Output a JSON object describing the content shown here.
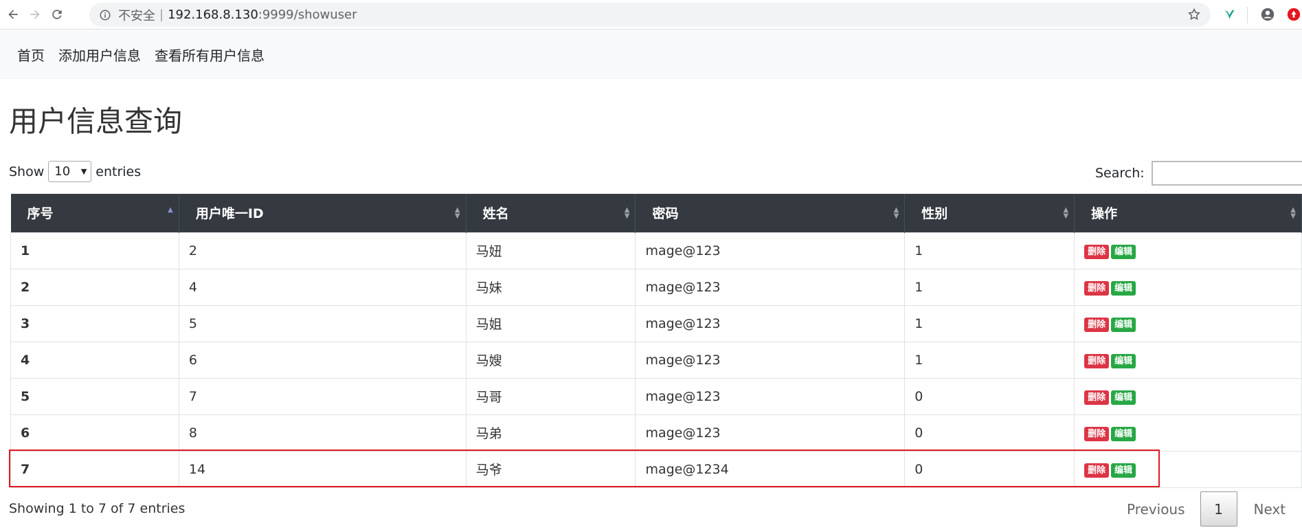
{
  "browser": {
    "insecure_label": "不安全",
    "separator": "|",
    "url_host": "192.168.8.130",
    "url_path": ":9999/showuser"
  },
  "navbar": {
    "home": "首页",
    "add_user": "添加用户信息",
    "view_all": "查看所有用户信息"
  },
  "page_title": "用户信息查询",
  "length": {
    "show": "Show",
    "value": "10",
    "entries": "entries"
  },
  "search": {
    "label": "Search:",
    "value": ""
  },
  "table": {
    "headers": [
      "序号",
      "用户唯一ID",
      "姓名",
      "密码",
      "性别",
      "操作"
    ],
    "rows": [
      {
        "idx": "1",
        "uid": "2",
        "name": "马妞",
        "pwd": "mage@123",
        "sex": "1"
      },
      {
        "idx": "2",
        "uid": "4",
        "name": "马妹",
        "pwd": "mage@123",
        "sex": "1"
      },
      {
        "idx": "3",
        "uid": "5",
        "name": "马姐",
        "pwd": "mage@123",
        "sex": "1"
      },
      {
        "idx": "4",
        "uid": "6",
        "name": "马嫂",
        "pwd": "mage@123",
        "sex": "1"
      },
      {
        "idx": "5",
        "uid": "7",
        "name": "马哥",
        "pwd": "mage@123",
        "sex": "0"
      },
      {
        "idx": "6",
        "uid": "8",
        "name": "马弟",
        "pwd": "mage@123",
        "sex": "0"
      },
      {
        "idx": "7",
        "uid": "14",
        "name": "马爷",
        "pwd": "mage@1234",
        "sex": "0"
      }
    ],
    "delete_label": "删除",
    "edit_label": "编辑"
  },
  "footer": {
    "info": "Showing 1 to 7 of 7 entries",
    "previous": "Previous",
    "page": "1",
    "next": "Next"
  },
  "colors": {
    "header_bg": "#343a40",
    "delete": "#dc3545",
    "edit": "#28a745",
    "highlight": "#e0181e"
  }
}
